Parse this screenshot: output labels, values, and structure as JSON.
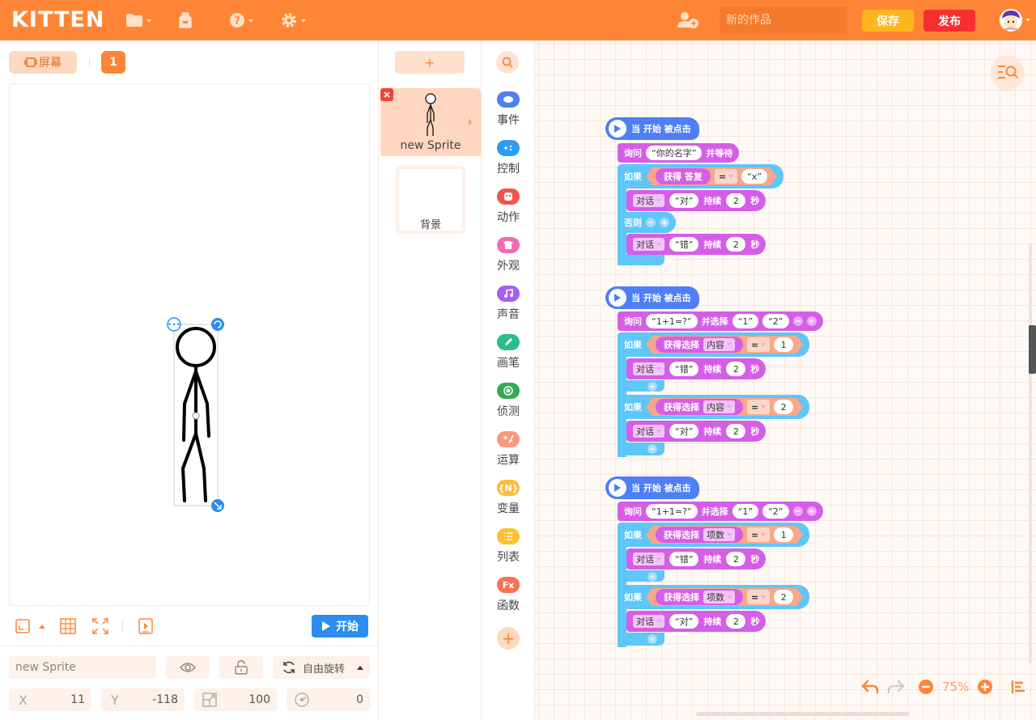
{
  "topbar": {
    "logo": "KITTEN",
    "title_placeholder": "新的作品",
    "save_label": "保存",
    "publish_label": "发布"
  },
  "stage": {
    "screen_label": "屏幕",
    "screen_number": "1",
    "start_label": "开始"
  },
  "sprite_props": {
    "name": "new Sprite",
    "rotation_label": "自由旋转",
    "x_label": "X",
    "x_value": "11",
    "y_label": "Y",
    "y_value": "-118",
    "size_value": "100",
    "direction_value": "0"
  },
  "sprites": {
    "add_label": "+",
    "items": [
      {
        "name": "new Sprite"
      }
    ],
    "background_label": "背景"
  },
  "categories": [
    {
      "label": "事件",
      "color": "#4f7ff5",
      "icon": "event-icon"
    },
    {
      "label": "控制",
      "color": "#2d9cf6",
      "icon": "control-icon"
    },
    {
      "label": "动作",
      "color": "#f0554c",
      "icon": "motion-icon"
    },
    {
      "label": "外观",
      "color": "#f06bb3",
      "icon": "looks-icon"
    },
    {
      "label": "声音",
      "color": "#a55ef5",
      "icon": "sound-icon"
    },
    {
      "label": "画笔",
      "color": "#2bbc8a",
      "icon": "pen-icon"
    },
    {
      "label": "侦测",
      "color": "#35a853",
      "icon": "sensing-icon"
    },
    {
      "label": "运算",
      "color": "#f79a7c",
      "icon": "operator-icon"
    },
    {
      "label": "变量",
      "color": "#fcbb3a",
      "icon": "variable-icon",
      "glyph": "{N}"
    },
    {
      "label": "列表",
      "color": "#fdc02f",
      "icon": "list-icon"
    },
    {
      "label": "函数",
      "color": "#fa7154",
      "icon": "function-icon",
      "glyph": "Fx"
    }
  ],
  "workspace": {
    "zoom": "75%",
    "scripts": [
      {
        "hat": "当 开始 被点击",
        "ask_prefix": "询问",
        "ask_text": "你的名字",
        "ask_suffix": "并等待",
        "if_label": "如果",
        "get_answer": "获得 答复",
        "op": "=",
        "compare": "x",
        "say1_label": "对话",
        "say1_text": "对",
        "say1_dur_label": "持续",
        "say1_dur": "2",
        "say1_unit": "秒",
        "else_label": "否则",
        "say2_label": "对话",
        "say2_text": "错",
        "say2_dur_label": "持续",
        "say2_dur": "2",
        "say2_unit": "秒"
      },
      {
        "hat": "当 开始 被点击",
        "ask_prefix": "询问",
        "ask_text": "1+1=?",
        "ask_suffix": "并选择",
        "opt1": "1",
        "opt2": "2",
        "if1_label": "如果",
        "get1": "获得选择",
        "get1_dd": "内容",
        "op1": "=",
        "cmp1": "1",
        "say1_label": "对话",
        "say1_text": "错",
        "say1_dur_label": "持续",
        "say1_dur": "2",
        "say1_unit": "秒",
        "if2_label": "如果",
        "get2": "获得选择",
        "get2_dd": "内容",
        "op2": "=",
        "cmp2": "2",
        "say2_label": "对话",
        "say2_text": "对",
        "say2_dur_label": "持续",
        "say2_dur": "2",
        "say2_unit": "秒"
      },
      {
        "hat": "当 开始 被点击",
        "ask_prefix": "询问",
        "ask_text": "1+1=?",
        "ask_suffix": "并选择",
        "opt1": "1",
        "opt2": "2",
        "if1_label": "如果",
        "get1": "获得选择",
        "get1_dd": "项数",
        "op1": "=",
        "cmp1": "1",
        "say1_label": "对话",
        "say1_text": "错",
        "say1_dur_label": "持续",
        "say1_dur": "2",
        "say1_unit": "秒",
        "if2_label": "如果",
        "get2": "获得选择",
        "get2_dd": "项数",
        "op2": "=",
        "cmp2": "2",
        "say2_label": "对话",
        "say2_text": "对",
        "say2_dur_label": "持续",
        "say2_dur": "2",
        "say2_unit": "秒"
      }
    ]
  }
}
